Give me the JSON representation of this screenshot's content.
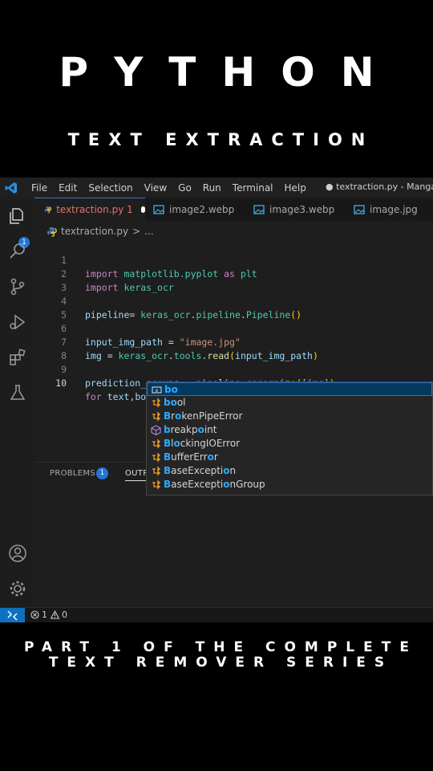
{
  "overlay": {
    "title": "PYTHON",
    "subtitle": "TEXT EXTRACTION",
    "footer_line1": "PART 1 OF THE COMPLETE",
    "footer_line2": "TEXT REMOVER SERIES"
  },
  "menu": [
    "File",
    "Edit",
    "Selection",
    "View",
    "Go",
    "Run",
    "Terminal",
    "Help"
  ],
  "window_title": "● textraction.py - Mangas -",
  "activity_badge": "1",
  "tabs": [
    {
      "label": "textraction.py 1",
      "icon": "python-icon",
      "active": true,
      "modified": true
    },
    {
      "label": "image2.webp",
      "icon": "image-icon"
    },
    {
      "label": "image3.webp",
      "icon": "image-icon"
    },
    {
      "label": "image.jpg",
      "icon": "image-icon"
    }
  ],
  "breadcrumb": {
    "file": "textraction.py",
    "separator": ">",
    "rest": "..."
  },
  "code": {
    "line_numbers": [
      "1",
      "2",
      "3",
      "4",
      "5",
      "6",
      "7",
      "8",
      "9",
      "10"
    ],
    "lines": [
      "import matplotlib.pyplot as plt",
      "import keras_ocr",
      "",
      "pipeline= keras_ocr.pipeline.Pipeline()",
      "",
      "input_img_path = \"image.jpg\"",
      "img = keras_ocr.tools.read(input_img_path)",
      "",
      "prediction_groups = pipeline.recognize([img])",
      "for text,bo"
    ]
  },
  "suggestions": [
    {
      "label": "bo",
      "icon": "variable-icon"
    },
    {
      "label": "bool",
      "icon": "class-icon"
    },
    {
      "label": "BrokenPipeError",
      "icon": "class-icon"
    },
    {
      "label": "breakpoint",
      "icon": "method-icon"
    },
    {
      "label": "BlockingIOError",
      "icon": "class-icon"
    },
    {
      "label": "BufferError",
      "icon": "class-icon"
    },
    {
      "label": "BaseException",
      "icon": "class-icon"
    },
    {
      "label": "BaseExceptionGroup",
      "icon": "class-icon"
    }
  ],
  "panel": {
    "problems_label": "PROBLEMS",
    "problems_count": "1",
    "output_label": "OUTPUT"
  },
  "status": {
    "errors": "1",
    "warnings": "0"
  },
  "colors": {
    "accent": "#0e70c0",
    "keyword": "#c586c0",
    "function": "#dcdcaa",
    "string": "#ce9178"
  }
}
